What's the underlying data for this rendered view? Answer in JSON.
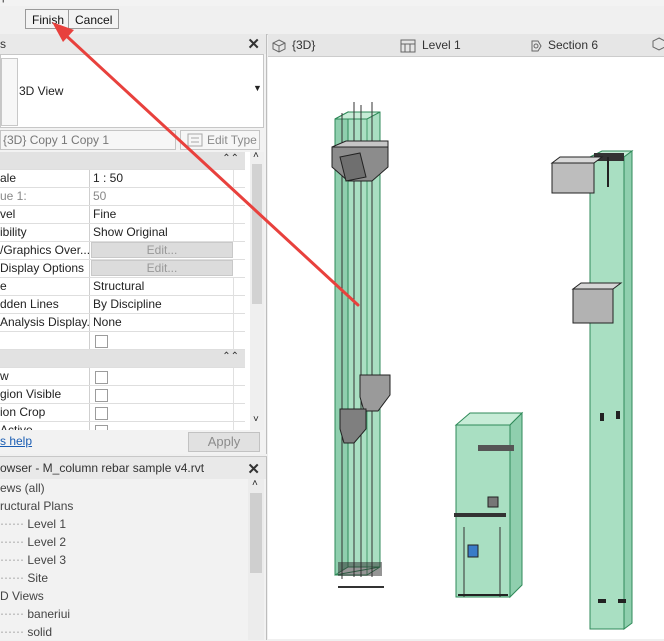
{
  "top_strip": {
    "left_text": "ple"
  },
  "options_bar": {
    "finish_label": "Finish",
    "cancel_label": "Cancel"
  },
  "properties": {
    "type_name": "3D View",
    "instance_name": "{3D} Copy 1 Copy 1",
    "edit_type_label": "Edit Type",
    "rows": [
      {
        "key": "ale",
        "value": "1 : 50"
      },
      {
        "key": "ue    1:",
        "value": "50"
      },
      {
        "key": "vel",
        "value": "Fine"
      },
      {
        "key": "ibility",
        "value": "Show Original"
      },
      {
        "key": "/Graphics Over...",
        "value": "Edit..."
      },
      {
        "key": "Display Options",
        "value": "Edit..."
      },
      {
        "key": "e",
        "value": "Structural"
      },
      {
        "key": "dden Lines",
        "value": "By Discipline"
      },
      {
        "key": "Analysis Display...",
        "value": "None"
      },
      {
        "key": "",
        "value": ""
      },
      {
        "key": "w",
        "value": ""
      },
      {
        "key": "gion Visible",
        "value": ""
      },
      {
        "key": "ion Crop",
        "value": ""
      },
      {
        "key": "Active",
        "value": ""
      }
    ],
    "help_label": "s help",
    "apply_label": "Apply"
  },
  "browser": {
    "title": "owser - M_column rebar sample v4.rvt",
    "items": [
      "ews (all)",
      "ructural Plans",
      "Level 1",
      "Level 2",
      "Level 3",
      "Site",
      "D Views",
      "baneriui",
      "solid"
    ]
  },
  "view_tabs": [
    {
      "label": "{3D}",
      "icon": "3d-view-icon"
    },
    {
      "label": "Level 1",
      "icon": "floor-plan-icon"
    },
    {
      "label": "Section 6",
      "icon": "section-icon"
    }
  ],
  "colors": {
    "column_fill": "#9fd9b9",
    "column_edge": "#2f8a59",
    "annotation_arrow": "#e8413d",
    "link": "#1a5db3"
  }
}
